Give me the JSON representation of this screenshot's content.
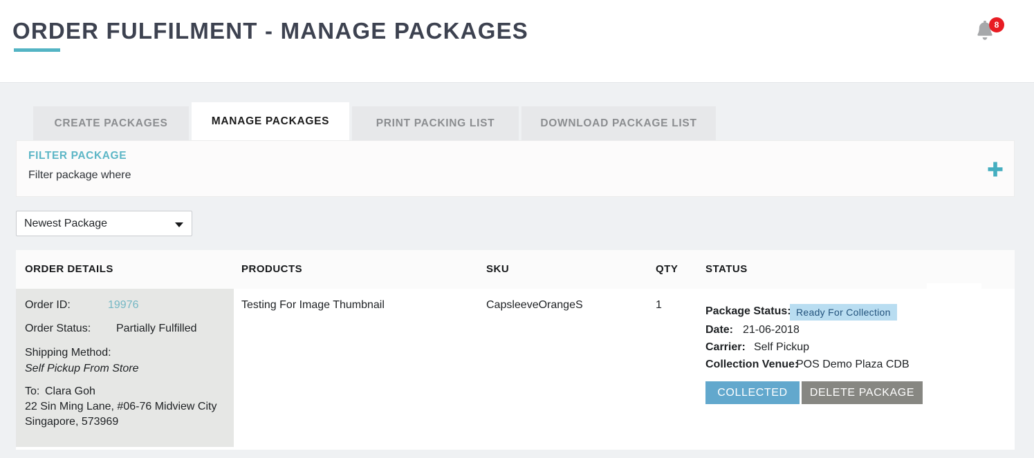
{
  "header": {
    "title": "Order Fulfilment - Manage Packages",
    "notifications": {
      "icon": "bell-icon",
      "count": "8",
      "badge_color": "#e81c23"
    },
    "accent_color": "#53b4c4"
  },
  "tabs": [
    {
      "label": "Create Packages",
      "active": false
    },
    {
      "label": "Manage Packages",
      "active": true
    },
    {
      "label": "Print Packing List",
      "active": false
    },
    {
      "label": "Download Package List",
      "active": false
    }
  ],
  "filter": {
    "title": "Filter Package",
    "subtitle": "Filter package where",
    "add_icon": "plus-icon",
    "title_color": "#5cb6c6"
  },
  "sort": {
    "selected": "Newest Package",
    "caret_icon": "chevron-down-icon"
  },
  "table": {
    "columns": [
      "Order Details",
      "Products",
      "SKU",
      "Qty",
      "Status"
    ],
    "rows": [
      {
        "order": {
          "order_id_label": "Order ID:",
          "order_id_value": "19976",
          "order_status_label": "Order Status:",
          "order_status_value": "Partially Fulfilled",
          "shipping_method_label": "Shipping Method:",
          "shipping_method_value": "Self Pickup From Store",
          "to_label": "To:",
          "to_name": "Clara Goh",
          "address_line1": "22 Sin Ming Lane, #06-76 Midview City",
          "address_line2": "Singapore, 573969"
        },
        "product": "Testing For Image Thumbnail",
        "sku": "CapsleeveOrangeS",
        "qty": "1",
        "status": {
          "package_status_label": "Package Status:",
          "package_status_value": "Ready For Collection",
          "date_label": "Date:",
          "date_value": "21-06-2018",
          "carrier_label": "Carrier:",
          "carrier_value": "Self Pickup",
          "venue_label": "Collection Venue:",
          "venue_value": "POS Demo Plaza CDB",
          "badge_bg": "#b9ddf1",
          "badge_text_color": "#22527c",
          "collected_button": "Collected",
          "delete_button": "Delete Package",
          "collected_color": "#62a8cd",
          "delete_color": "#878782"
        }
      }
    ]
  }
}
